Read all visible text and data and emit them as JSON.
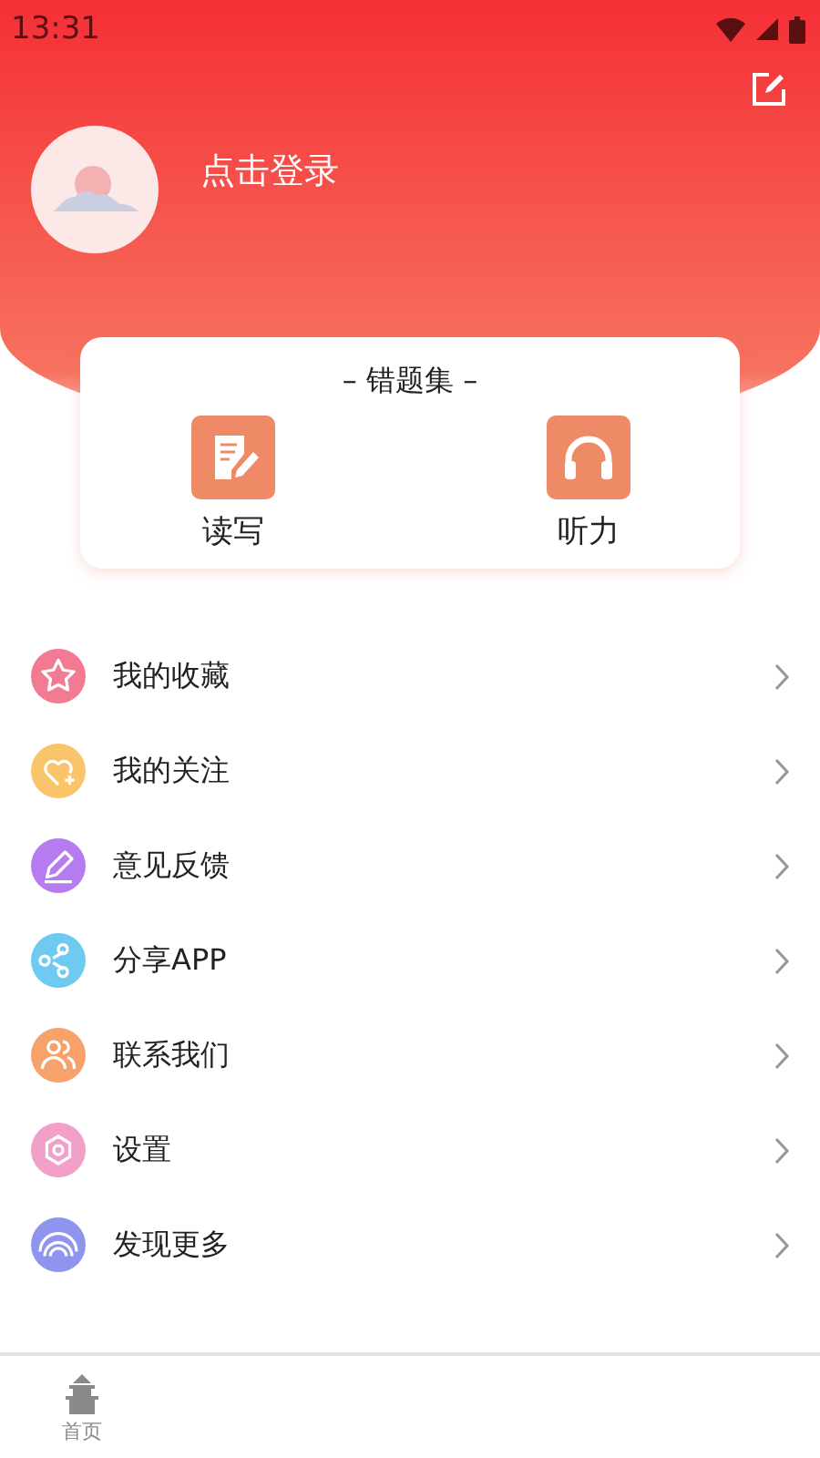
{
  "status_bar": {
    "time": "13:31"
  },
  "profile": {
    "login_label": "点击登录"
  },
  "mistakes": {
    "title": "– 错题集 –",
    "items": [
      {
        "label": "读写"
      },
      {
        "label": "听力"
      }
    ]
  },
  "menu": [
    {
      "label": "我的收藏",
      "color": "#f27a93"
    },
    {
      "label": "我的关注",
      "color": "#f9c46a"
    },
    {
      "label": "意见反馈",
      "color": "#b57bef"
    },
    {
      "label": "分享APP",
      "color": "#6fcaf2"
    },
    {
      "label": "联系我们",
      "color": "#f7a16b"
    },
    {
      "label": "设置",
      "color": "#f2a0c8"
    },
    {
      "label": "发现更多",
      "color": "#8f95ee"
    }
  ],
  "bottom_nav": [
    {
      "label": "首页",
      "selected": false
    }
  ]
}
